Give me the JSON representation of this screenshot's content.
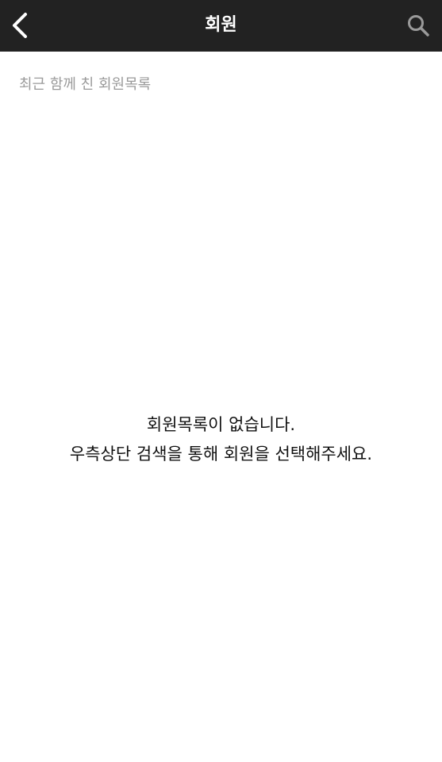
{
  "header": {
    "title": "회원",
    "back_icon": "chevron-left-icon",
    "search_icon": "search-icon",
    "background": "#222222"
  },
  "recent": {
    "section_label": "최근 함께 친 회원목록"
  },
  "empty_state": {
    "line1": "회원목록이 없습니다.",
    "line2": "우측상단 검색을 통해 회원을 선택해주세요."
  }
}
